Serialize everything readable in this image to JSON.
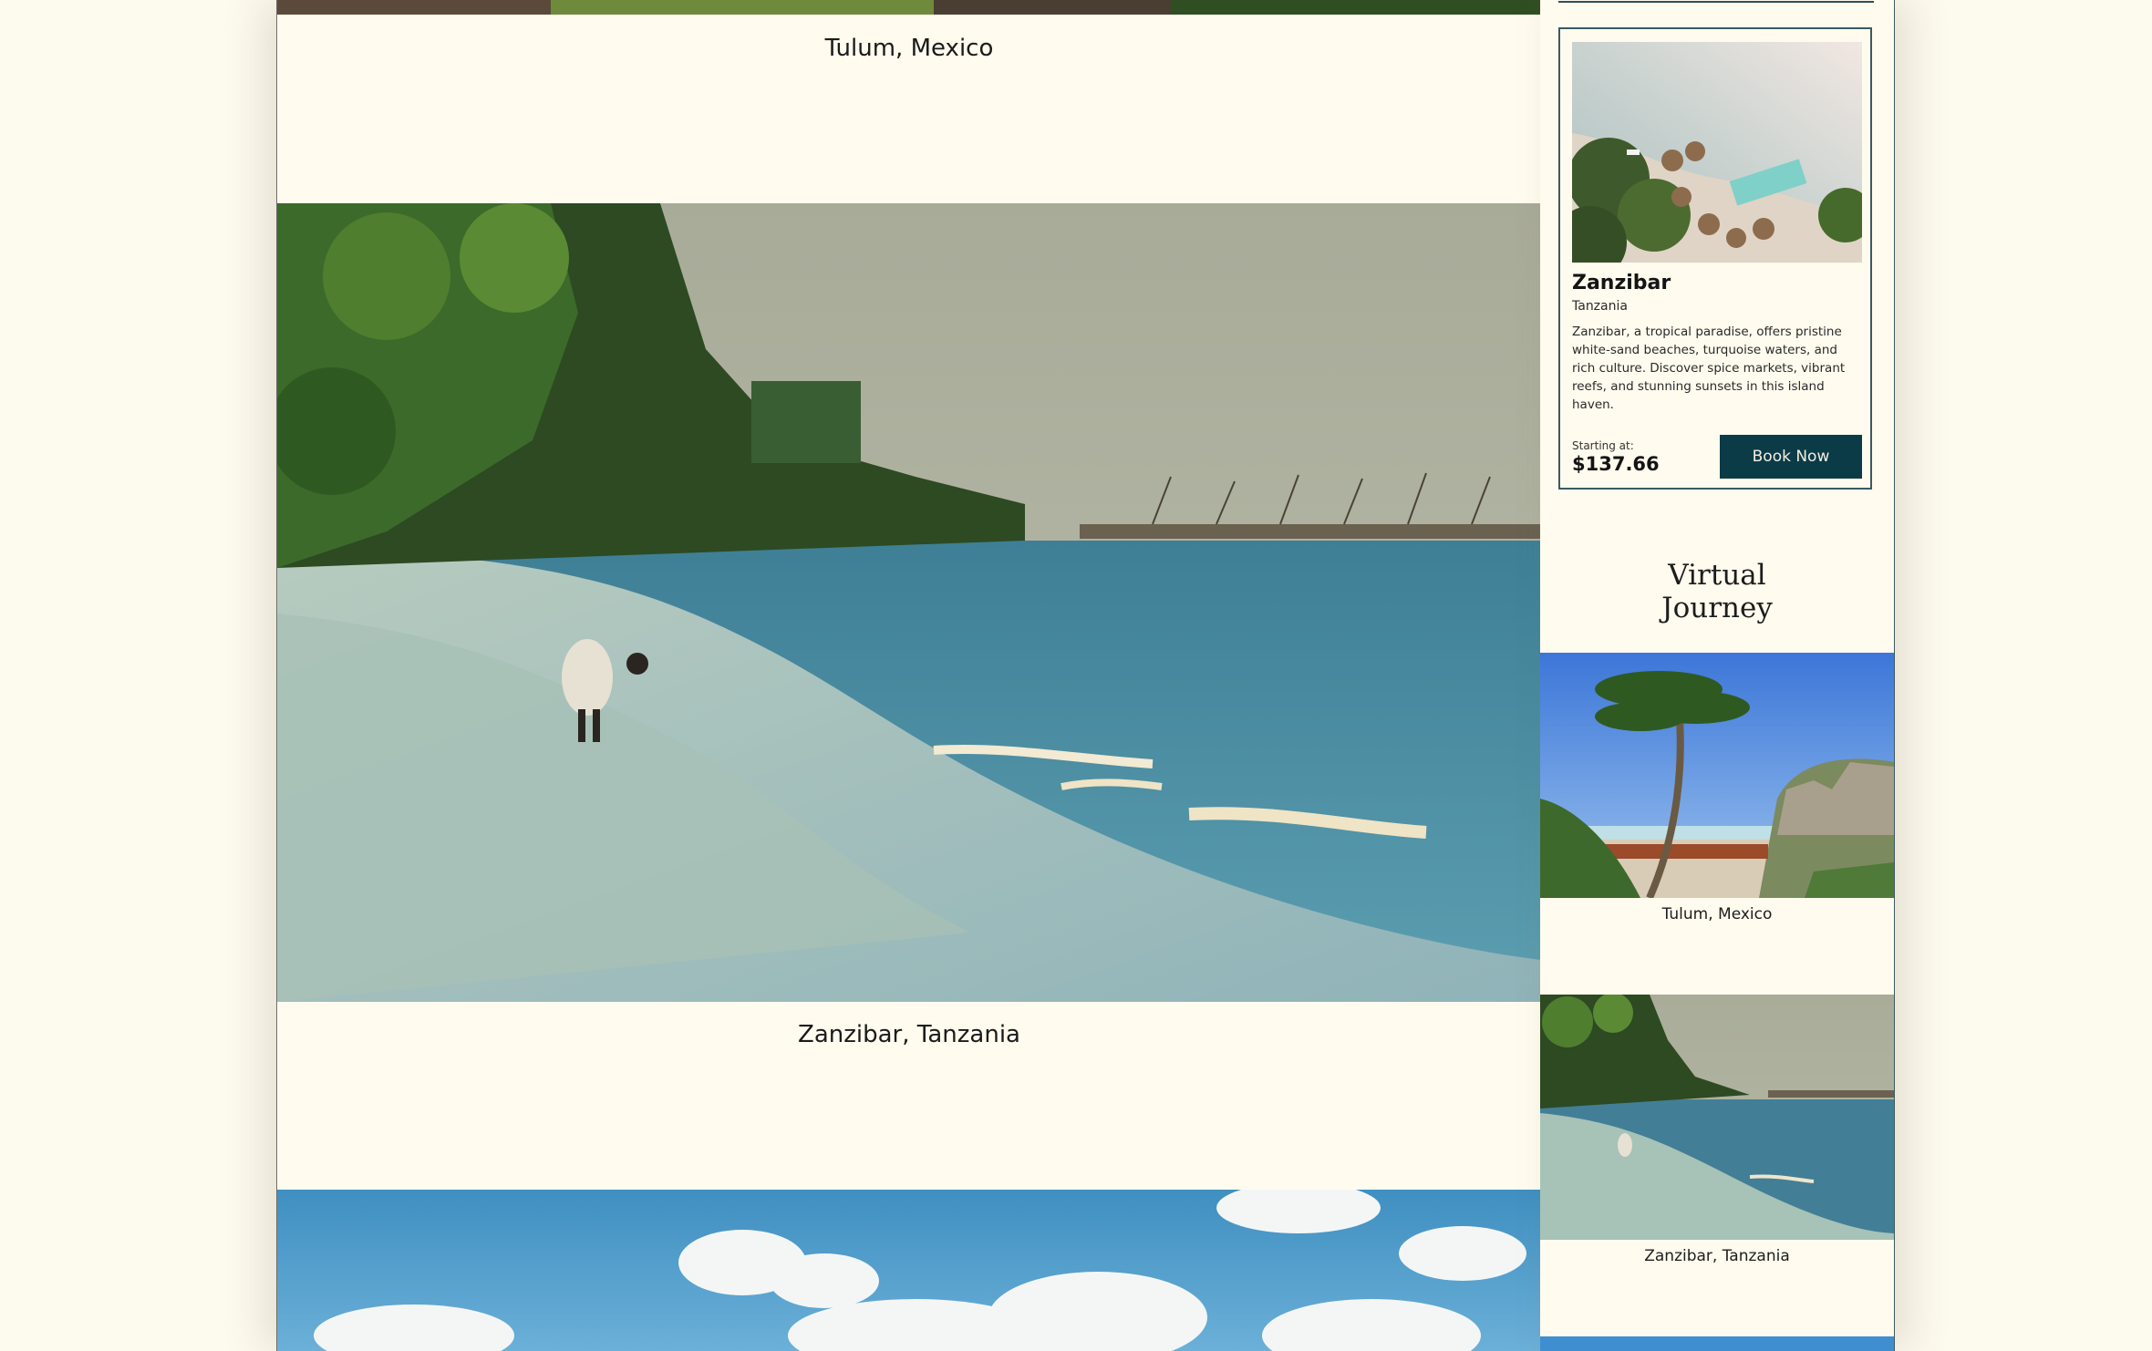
{
  "feed": {
    "items": [
      {
        "caption": "Tulum, Mexico",
        "scene": "tulum-ruins-photo"
      },
      {
        "caption": "Zanzibar, Tanzania",
        "scene": "zanzibar-beach-photo"
      },
      {
        "caption": "",
        "scene": "sky-clouds-photo"
      }
    ]
  },
  "sidebar": {
    "card": {
      "title": "Zanzibar",
      "subtitle": "Tanzania",
      "description": "Zanzibar, a tropical paradise, offers pristine white-sand beaches, turquoise waters, and rich culture. Discover spice markets, vibrant reefs, and stunning sunsets in this island haven.",
      "price_label": "Starting at:",
      "price": "$137.66",
      "button_label": "Book Now",
      "image": "resort-aerial-photo"
    },
    "virtual_journey": {
      "title": "Virtual Journey",
      "items": [
        {
          "caption": "Tulum, Mexico",
          "image": "tulum-palm-photo"
        },
        {
          "caption": "Zanzibar, Tanzania",
          "image": "zanzibar-beach-photo"
        }
      ]
    }
  },
  "colors": {
    "page_bg": "#fdfaee",
    "panel_bg": "#fffbee",
    "accent": "#0b3b47",
    "border": "#3b5a61"
  }
}
